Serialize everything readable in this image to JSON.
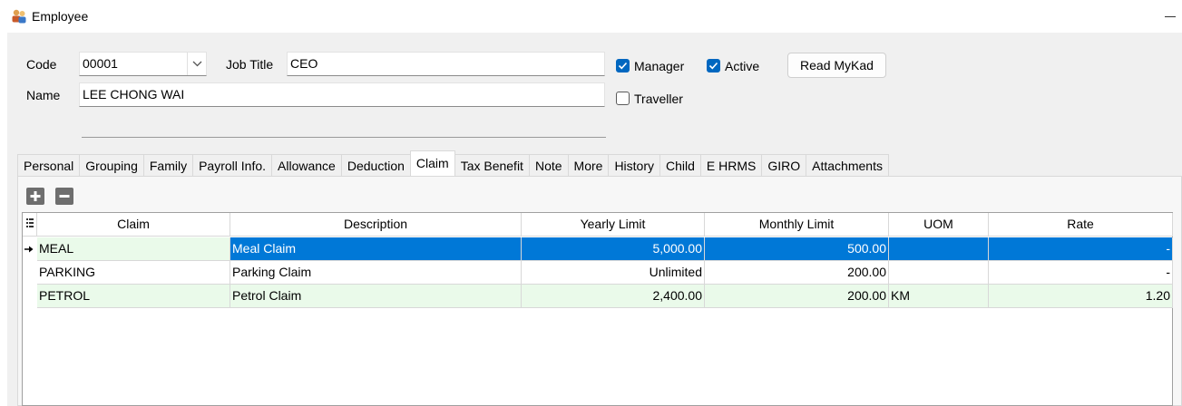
{
  "window": {
    "title": "Employee",
    "icon": "employee-icon"
  },
  "form": {
    "code_label": "Code",
    "code_value": "00001",
    "job_title_label": "Job Title",
    "job_title_value": "CEO",
    "name_label": "Name",
    "name_value": "LEE CHONG WAI",
    "manager_label": "Manager",
    "manager_checked": true,
    "active_label": "Active",
    "active_checked": true,
    "traveller_label": "Traveller",
    "traveller_checked": false,
    "read_mykad_label": "Read MyKad"
  },
  "tabs": [
    {
      "label": "Personal"
    },
    {
      "label": "Grouping"
    },
    {
      "label": "Family"
    },
    {
      "label": "Payroll Info."
    },
    {
      "label": "Allowance"
    },
    {
      "label": "Deduction"
    },
    {
      "label": "Claim",
      "active": true
    },
    {
      "label": "Tax Benefit"
    },
    {
      "label": "Note"
    },
    {
      "label": "More"
    },
    {
      "label": "History"
    },
    {
      "label": "Child"
    },
    {
      "label": "E HRMS"
    },
    {
      "label": "GIRO"
    },
    {
      "label": "Attachments"
    }
  ],
  "toolbar": {
    "add_icon": "plus-icon",
    "remove_icon": "minus-icon"
  },
  "grid": {
    "columns": [
      "Claim",
      "Description",
      "Yearly Limit",
      "Monthly Limit",
      "UOM",
      "Rate"
    ],
    "rows": [
      {
        "claim": "MEAL",
        "description": "Meal Claim",
        "yearly": "5,000.00",
        "monthly": "500.00",
        "uom": "",
        "rate": "-",
        "selected": true
      },
      {
        "claim": "PARKING",
        "description": "Parking Claim",
        "yearly": "Unlimited",
        "monthly": "200.00",
        "uom": "",
        "rate": "-",
        "selected": false
      },
      {
        "claim": "PETROL",
        "description": "Petrol Claim",
        "yearly": "2,400.00",
        "monthly": "200.00",
        "uom": "KM",
        "rate": "1.20",
        "selected": false
      }
    ]
  },
  "colors": {
    "accent": "#0067c0",
    "selected_row": "#0078d7",
    "alt_row": "#eafaea",
    "panel_bg": "#f0f0f0"
  }
}
